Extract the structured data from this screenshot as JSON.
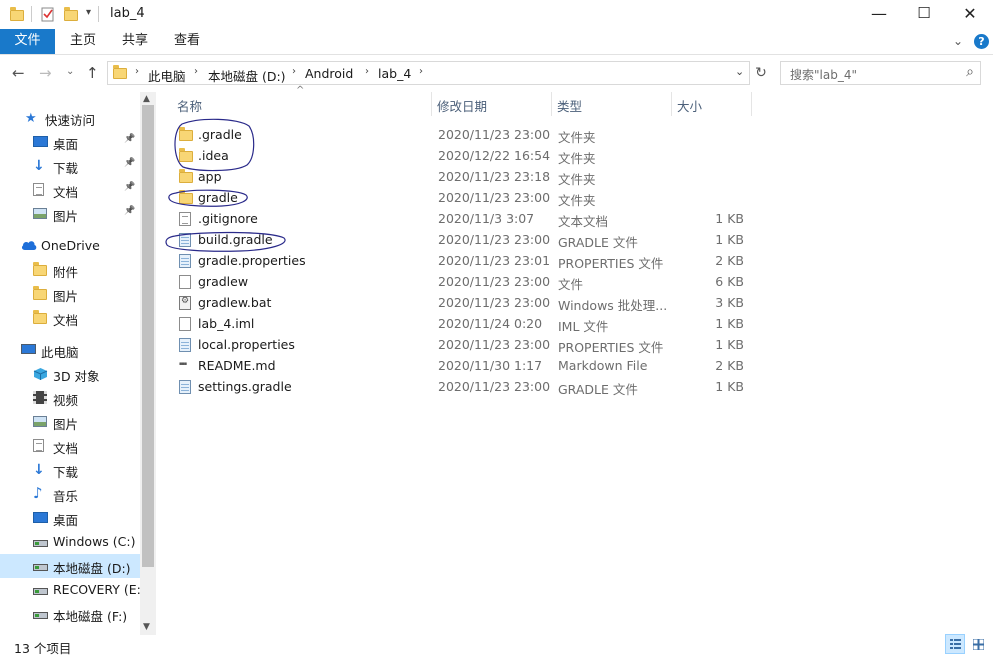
{
  "window": {
    "title": "lab_4",
    "controls": {
      "minimize": "—",
      "maximize": "☐",
      "close": "✕"
    }
  },
  "ribbon": {
    "tabs": [
      {
        "label": "文件"
      },
      {
        "label": "主页"
      },
      {
        "label": "共享"
      },
      {
        "label": "查看"
      }
    ],
    "help": "?"
  },
  "address": {
    "breadcrumbs": [
      "此电脑",
      "本地磁盘 (D:)",
      "Android",
      "lab_4"
    ],
    "search_placeholder": "搜索\"lab_4\""
  },
  "columns": {
    "name": "名称",
    "date": "修改日期",
    "type": "类型",
    "size": "大小"
  },
  "sidebar": {
    "items": [
      {
        "label": "快速访问",
        "icon": "star-icon",
        "pinned": false
      },
      {
        "label": "桌面",
        "icon": "desktop-icon",
        "pinned": true
      },
      {
        "label": "下载",
        "icon": "download-icon",
        "pinned": true
      },
      {
        "label": "文档",
        "icon": "document-icon",
        "pinned": true
      },
      {
        "label": "图片",
        "icon": "picture-icon",
        "pinned": true
      },
      {
        "label": "OneDrive",
        "icon": "cloud-icon",
        "pinned": false
      },
      {
        "label": "附件",
        "icon": "folder-icon",
        "pinned": false
      },
      {
        "label": "图片",
        "icon": "folder-icon",
        "pinned": false
      },
      {
        "label": "文档",
        "icon": "folder-icon",
        "pinned": false
      },
      {
        "label": "此电脑",
        "icon": "computer-icon",
        "pinned": false
      },
      {
        "label": "3D 对象",
        "icon": "cube-icon",
        "pinned": false
      },
      {
        "label": "视频",
        "icon": "video-icon",
        "pinned": false
      },
      {
        "label": "图片",
        "icon": "picture-icon",
        "pinned": false
      },
      {
        "label": "文档",
        "icon": "document-icon",
        "pinned": false
      },
      {
        "label": "下载",
        "icon": "download-icon",
        "pinned": false
      },
      {
        "label": "音乐",
        "icon": "music-icon",
        "pinned": false
      },
      {
        "label": "桌面",
        "icon": "desktop-icon",
        "pinned": false
      },
      {
        "label": "Windows (C:)",
        "icon": "drive-icon",
        "pinned": false
      },
      {
        "label": "本地磁盘 (D:)",
        "icon": "drive-icon",
        "pinned": false,
        "selected": true
      },
      {
        "label": "RECOVERY (E:)",
        "icon": "drive-icon",
        "pinned": false
      },
      {
        "label": "本地磁盘 (F:)",
        "icon": "drive-icon",
        "pinned": false
      }
    ]
  },
  "files": [
    {
      "name": ".gradle",
      "date": "2020/11/23 23:00",
      "type": "文件夹",
      "size": "",
      "icon": "folder-icon"
    },
    {
      "name": ".idea",
      "date": "2020/12/22 16:54",
      "type": "文件夹",
      "size": "",
      "icon": "folder-icon"
    },
    {
      "name": "app",
      "date": "2020/11/23 23:18",
      "type": "文件夹",
      "size": "",
      "icon": "folder-icon"
    },
    {
      "name": "gradle",
      "date": "2020/11/23 23:00",
      "type": "文件夹",
      "size": "",
      "icon": "folder-icon"
    },
    {
      "name": ".gitignore",
      "date": "2020/11/3 3:07",
      "type": "文本文档",
      "size": "1 KB",
      "icon": "text-file-icon"
    },
    {
      "name": "build.gradle",
      "date": "2020/11/23 23:00",
      "type": "GRADLE 文件",
      "size": "1 KB",
      "icon": "gradle-file-icon"
    },
    {
      "name": "gradle.properties",
      "date": "2020/11/23 23:01",
      "type": "PROPERTIES 文件",
      "size": "2 KB",
      "icon": "gradle-file-icon"
    },
    {
      "name": "gradlew",
      "date": "2020/11/23 23:00",
      "type": "文件",
      "size": "6 KB",
      "icon": "blank-file-icon"
    },
    {
      "name": "gradlew.bat",
      "date": "2020/11/23 23:00",
      "type": "Windows 批处理...",
      "size": "3 KB",
      "icon": "batch-file-icon"
    },
    {
      "name": "lab_4.iml",
      "date": "2020/11/24 0:20",
      "type": "IML 文件",
      "size": "1 KB",
      "icon": "blank-file-icon"
    },
    {
      "name": "local.properties",
      "date": "2020/11/23 23:00",
      "type": "PROPERTIES 文件",
      "size": "1 KB",
      "icon": "gradle-file-icon"
    },
    {
      "name": "README.md",
      "date": "2020/11/30 1:17",
      "type": "Markdown File",
      "size": "2 KB",
      "icon": "markdown-file-icon"
    },
    {
      "name": "settings.gradle",
      "date": "2020/11/23 23:00",
      "type": "GRADLE 文件",
      "size": "1 KB",
      "icon": "gradle-file-icon"
    }
  ],
  "status": {
    "count": "13 个项目"
  },
  "colors": {
    "accent": "#1979ca",
    "selection": "#cce8ff",
    "annotation": "#2a2a8a"
  }
}
